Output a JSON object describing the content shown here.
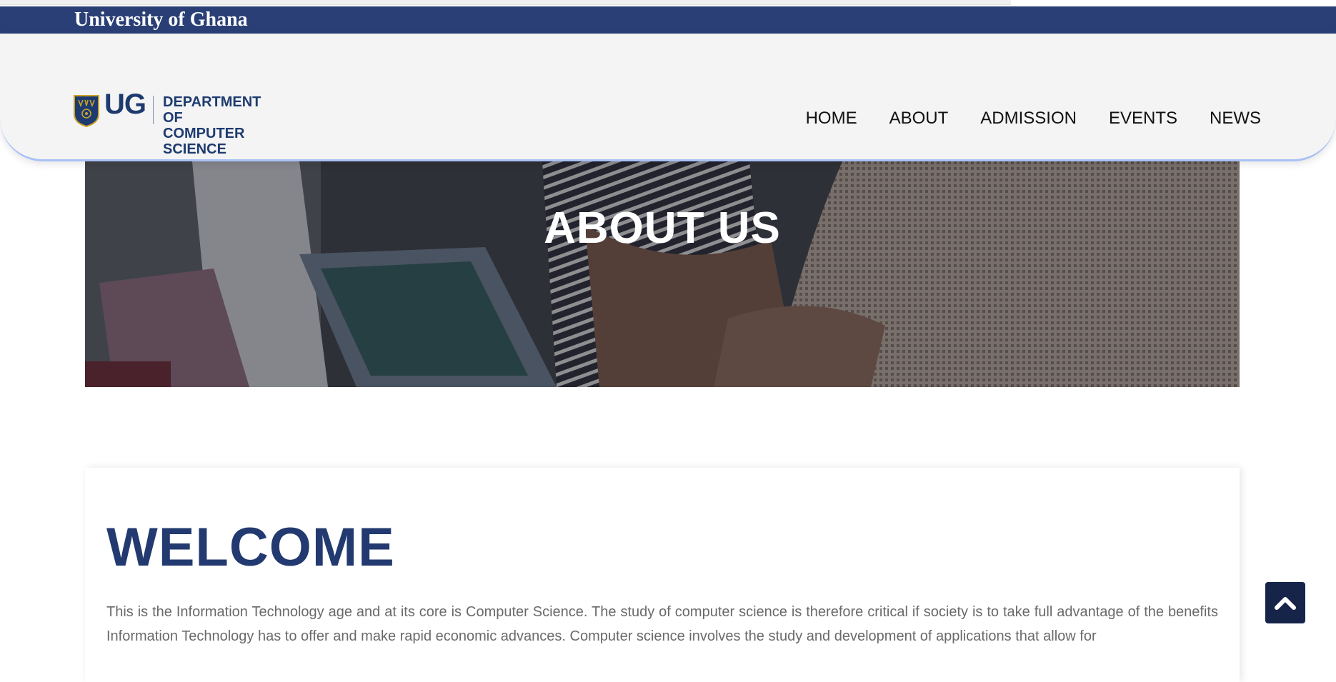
{
  "topbar": {
    "title": "University of Ghana"
  },
  "logo": {
    "ug": "UG",
    "dept_line1": "DEPARTMENT OF",
    "dept_line2": "COMPUTER SCIENCE"
  },
  "nav": {
    "items": [
      "HOME",
      "ABOUT",
      "ADMISSION",
      "EVENTS",
      "NEWS"
    ]
  },
  "hero": {
    "title": "ABOUT US"
  },
  "welcome": {
    "title": "WELCOME",
    "body": "This is the Information Technology age and at its core is Computer Science. The study of computer science is therefore critical if society is to take full advantage of the benefits Information Technology has to offer and make rapid economic advances. Computer science involves the study and development of applications that allow for"
  },
  "icons": {
    "scroll_top": "chevron-up-icon",
    "crest": "ug-crest-icon"
  },
  "colors": {
    "brand_navy": "#293f75",
    "heading_blue": "#223a70",
    "button_dark": "#16244a"
  }
}
